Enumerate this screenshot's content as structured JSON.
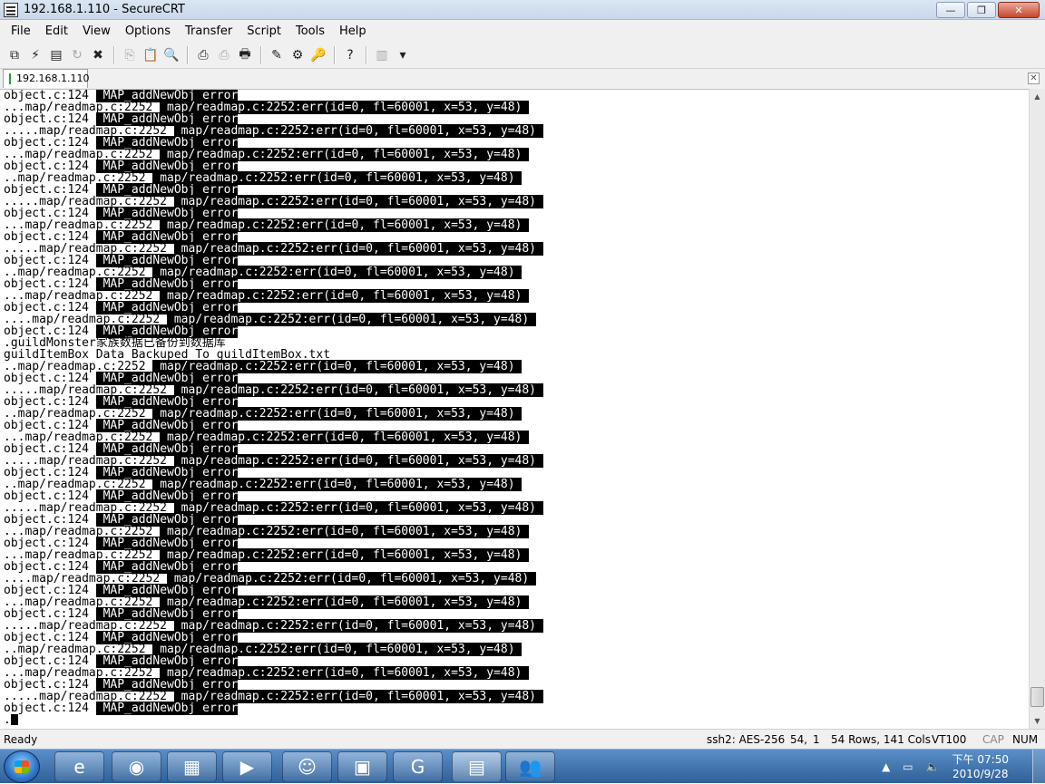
{
  "window": {
    "title": "192.168.1.110 - SecureCRT",
    "minimize": "—",
    "maximize": "❐",
    "close": "✕"
  },
  "menu": [
    "File",
    "Edit",
    "View",
    "Options",
    "Transfer",
    "Script",
    "Tools",
    "Help"
  ],
  "toolbar": {
    "icons": [
      {
        "name": "connect-icon",
        "glyph": "⧉",
        "enabled": true
      },
      {
        "name": "quick-connect-icon",
        "glyph": "⚡",
        "enabled": true
      },
      {
        "name": "connect-in-tab-icon",
        "glyph": "▤",
        "enabled": true
      },
      {
        "name": "reconnect-icon",
        "glyph": "↻",
        "enabled": false
      },
      {
        "name": "disconnect-icon",
        "glyph": "✖",
        "enabled": true
      },
      {
        "name": "sep"
      },
      {
        "name": "copy-icon",
        "glyph": "⎘",
        "enabled": false
      },
      {
        "name": "paste-icon",
        "glyph": "📋",
        "enabled": false
      },
      {
        "name": "find-icon",
        "glyph": "🔍",
        "enabled": true
      },
      {
        "name": "sep"
      },
      {
        "name": "print-screen-icon",
        "glyph": "⎙",
        "enabled": true
      },
      {
        "name": "print-selection-icon",
        "glyph": "⎙",
        "enabled": false
      },
      {
        "name": "printer-icon",
        "glyph": "🖶",
        "enabled": true
      },
      {
        "name": "sep"
      },
      {
        "name": "session-options-icon",
        "glyph": "✎",
        "enabled": true
      },
      {
        "name": "global-options-icon",
        "glyph": "⚙",
        "enabled": true
      },
      {
        "name": "keymap-icon",
        "glyph": "🔑",
        "enabled": true
      },
      {
        "name": "sep"
      },
      {
        "name": "help-icon",
        "glyph": "?",
        "enabled": true
      },
      {
        "name": "sep"
      },
      {
        "name": "customize-toolbar-icon",
        "glyph": "▥",
        "enabled": false
      },
      {
        "name": "toolbar-overflow-icon",
        "glyph": "▾",
        "enabled": true
      }
    ]
  },
  "tabs": [
    {
      "label": "192.168.1.110"
    }
  ],
  "tab_close": "✕",
  "terminal": {
    "lines": [
      [
        [
          "object.c:124 ",
          false
        ],
        [
          " MAP_addNewObj error",
          true
        ]
      ],
      [
        [
          "...map/readmap.c:2252 ",
          false
        ],
        [
          " map/readmap.c:2252:err(id=0, fl=60001, x=53, y=48) ",
          true
        ]
      ],
      [
        [
          "object.c:124 ",
          false
        ],
        [
          " MAP_addNewObj error",
          true
        ]
      ],
      [
        [
          ".....map/readmap.c:2252 ",
          false
        ],
        [
          " map/readmap.c:2252:err(id=0, fl=60001, x=53, y=48) ",
          true
        ]
      ],
      [
        [
          "object.c:124 ",
          false
        ],
        [
          " MAP_addNewObj error",
          true
        ]
      ],
      [
        [
          "...map/readmap.c:2252 ",
          false
        ],
        [
          " map/readmap.c:2252:err(id=0, fl=60001, x=53, y=48) ",
          true
        ]
      ],
      [
        [
          "object.c:124 ",
          false
        ],
        [
          " MAP_addNewObj error",
          true
        ]
      ],
      [
        [
          "..map/readmap.c:2252 ",
          false
        ],
        [
          " map/readmap.c:2252:err(id=0, fl=60001, x=53, y=48) ",
          true
        ]
      ],
      [
        [
          "object.c:124 ",
          false
        ],
        [
          " MAP_addNewObj error",
          true
        ]
      ],
      [
        [
          ".....map/readmap.c:2252 ",
          false
        ],
        [
          " map/readmap.c:2252:err(id=0, fl=60001, x=53, y=48) ",
          true
        ]
      ],
      [
        [
          "object.c:124 ",
          false
        ],
        [
          " MAP_addNewObj error",
          true
        ]
      ],
      [
        [
          "...map/readmap.c:2252 ",
          false
        ],
        [
          " map/readmap.c:2252:err(id=0, fl=60001, x=53, y=48) ",
          true
        ]
      ],
      [
        [
          "object.c:124 ",
          false
        ],
        [
          " MAP_addNewObj error",
          true
        ]
      ],
      [
        [
          ".....map/readmap.c:2252 ",
          false
        ],
        [
          " map/readmap.c:2252:err(id=0, fl=60001, x=53, y=48) ",
          true
        ]
      ],
      [
        [
          "object.c:124 ",
          false
        ],
        [
          " MAP_addNewObj error",
          true
        ]
      ],
      [
        [
          "..map/readmap.c:2252 ",
          false
        ],
        [
          " map/readmap.c:2252:err(id=0, fl=60001, x=53, y=48) ",
          true
        ]
      ],
      [
        [
          "object.c:124 ",
          false
        ],
        [
          " MAP_addNewObj error",
          true
        ]
      ],
      [
        [
          "...map/readmap.c:2252 ",
          false
        ],
        [
          " map/readmap.c:2252:err(id=0, fl=60001, x=53, y=48) ",
          true
        ]
      ],
      [
        [
          "object.c:124 ",
          false
        ],
        [
          " MAP_addNewObj error",
          true
        ]
      ],
      [
        [
          "....map/readmap.c:2252 ",
          false
        ],
        [
          " map/readmap.c:2252:err(id=0, fl=60001, x=53, y=48) ",
          true
        ]
      ],
      [
        [
          "object.c:124 ",
          false
        ],
        [
          " MAP_addNewObj error",
          true
        ]
      ],
      [
        [
          ".guildMonster家族数据已备份到数据库",
          false
        ]
      ],
      [
        [
          "guildItemBox Data Backuped To guildItemBox.txt",
          false
        ]
      ],
      [
        [
          "..map/readmap.c:2252 ",
          false
        ],
        [
          " map/readmap.c:2252:err(id=0, fl=60001, x=53, y=48) ",
          true
        ]
      ],
      [
        [
          "object.c:124 ",
          false
        ],
        [
          " MAP_addNewObj error",
          true
        ]
      ],
      [
        [
          ".....map/readmap.c:2252 ",
          false
        ],
        [
          " map/readmap.c:2252:err(id=0, fl=60001, x=53, y=48) ",
          true
        ]
      ],
      [
        [
          "object.c:124 ",
          false
        ],
        [
          " MAP_addNewObj error",
          true
        ]
      ],
      [
        [
          "..map/readmap.c:2252 ",
          false
        ],
        [
          " map/readmap.c:2252:err(id=0, fl=60001, x=53, y=48) ",
          true
        ]
      ],
      [
        [
          "object.c:124 ",
          false
        ],
        [
          " MAP_addNewObj error",
          true
        ]
      ],
      [
        [
          "...map/readmap.c:2252 ",
          false
        ],
        [
          " map/readmap.c:2252:err(id=0, fl=60001, x=53, y=48) ",
          true
        ]
      ],
      [
        [
          "object.c:124 ",
          false
        ],
        [
          " MAP_addNewObj error",
          true
        ]
      ],
      [
        [
          ".....map/readmap.c:2252 ",
          false
        ],
        [
          " map/readmap.c:2252:err(id=0, fl=60001, x=53, y=48) ",
          true
        ]
      ],
      [
        [
          "object.c:124 ",
          false
        ],
        [
          " MAP_addNewObj error",
          true
        ]
      ],
      [
        [
          "..map/readmap.c:2252 ",
          false
        ],
        [
          " map/readmap.c:2252:err(id=0, fl=60001, x=53, y=48) ",
          true
        ]
      ],
      [
        [
          "object.c:124 ",
          false
        ],
        [
          " MAP_addNewObj error",
          true
        ]
      ],
      [
        [
          ".....map/readmap.c:2252 ",
          false
        ],
        [
          " map/readmap.c:2252:err(id=0, fl=60001, x=53, y=48) ",
          true
        ]
      ],
      [
        [
          "object.c:124 ",
          false
        ],
        [
          " MAP_addNewObj error",
          true
        ]
      ],
      [
        [
          "...map/readmap.c:2252 ",
          false
        ],
        [
          " map/readmap.c:2252:err(id=0, fl=60001, x=53, y=48) ",
          true
        ]
      ],
      [
        [
          "object.c:124 ",
          false
        ],
        [
          " MAP_addNewObj error",
          true
        ]
      ],
      [
        [
          "...map/readmap.c:2252 ",
          false
        ],
        [
          " map/readmap.c:2252:err(id=0, fl=60001, x=53, y=48) ",
          true
        ]
      ],
      [
        [
          "object.c:124 ",
          false
        ],
        [
          " MAP_addNewObj error",
          true
        ]
      ],
      [
        [
          "....map/readmap.c:2252 ",
          false
        ],
        [
          " map/readmap.c:2252:err(id=0, fl=60001, x=53, y=48) ",
          true
        ]
      ],
      [
        [
          "object.c:124 ",
          false
        ],
        [
          " MAP_addNewObj error",
          true
        ]
      ],
      [
        [
          "...map/readmap.c:2252 ",
          false
        ],
        [
          " map/readmap.c:2252:err(id=0, fl=60001, x=53, y=48) ",
          true
        ]
      ],
      [
        [
          "object.c:124 ",
          false
        ],
        [
          " MAP_addNewObj error",
          true
        ]
      ],
      [
        [
          ".....map/readmap.c:2252 ",
          false
        ],
        [
          " map/readmap.c:2252:err(id=0, fl=60001, x=53, y=48) ",
          true
        ]
      ],
      [
        [
          "object.c:124 ",
          false
        ],
        [
          " MAP_addNewObj error",
          true
        ]
      ],
      [
        [
          "..map/readmap.c:2252 ",
          false
        ],
        [
          " map/readmap.c:2252:err(id=0, fl=60001, x=53, y=48) ",
          true
        ]
      ],
      [
        [
          "object.c:124 ",
          false
        ],
        [
          " MAP_addNewObj error",
          true
        ]
      ],
      [
        [
          "...map/readmap.c:2252 ",
          false
        ],
        [
          " map/readmap.c:2252:err(id=0, fl=60001, x=53, y=48) ",
          true
        ]
      ],
      [
        [
          "object.c:124 ",
          false
        ],
        [
          " MAP_addNewObj error",
          true
        ]
      ],
      [
        [
          ".....map/readmap.c:2252 ",
          false
        ],
        [
          " map/readmap.c:2252:err(id=0, fl=60001, x=53, y=48) ",
          true
        ]
      ],
      [
        [
          "object.c:124 ",
          false
        ],
        [
          " MAP_addNewObj error",
          true
        ]
      ]
    ],
    "prompt": "."
  },
  "status": {
    "ready": "Ready",
    "cipher": "ssh2: AES-256",
    "row": "54,",
    "col": "1",
    "size": "54 Rows, 141 Cols",
    "emulation": "VT100",
    "caps": "CAP",
    "num": "NUM"
  },
  "taskbar": {
    "buttons": [
      {
        "name": "ie-taskbar-icon",
        "glyph": "e"
      },
      {
        "name": "firefox-taskbar-icon",
        "glyph": "◉"
      },
      {
        "name": "explorer-taskbar-icon",
        "glyph": "▦"
      },
      {
        "name": "media-player-taskbar-icon",
        "glyph": "▶"
      },
      {
        "name": "game-taskbar-icon",
        "glyph": "☺"
      },
      {
        "name": "remote-desktop-taskbar-icon",
        "glyph": "▣"
      },
      {
        "name": "app-taskbar-icon",
        "glyph": "G"
      },
      {
        "name": "securecrt-taskbar-icon",
        "glyph": "▤"
      },
      {
        "name": "users-taskbar-icon",
        "glyph": "👥"
      }
    ],
    "tray_arrow": "▲",
    "clock_time": "下午 07:50",
    "clock_date": "2010/9/28"
  }
}
